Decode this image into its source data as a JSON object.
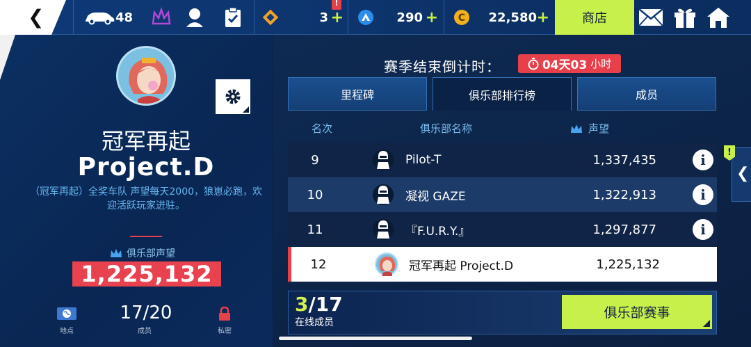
{
  "topbar": {
    "cars_count": "48",
    "tokens": "3",
    "blueprints": "290",
    "credits": "22,580",
    "shop_label": "商店"
  },
  "club": {
    "name_cn": "冠军再起",
    "name_en": "Project.D",
    "description": "（冠军再起）全奖车队 声望每天2000，狼崽必跑，欢迎活跃玩家进驻。",
    "reputation_label": "俱乐部声望",
    "reputation": "1,225,132",
    "location_label": "地点",
    "members": "17/20",
    "members_label": "成员",
    "privacy_label": "私密"
  },
  "season": {
    "countdown_label": "赛季结束倒计时：",
    "countdown_days": "04天03",
    "countdown_unit": "小时"
  },
  "tabs": [
    {
      "label": "里程碑"
    },
    {
      "label": "俱乐部排行榜"
    },
    {
      "label": "成员"
    }
  ],
  "table": {
    "headers": {
      "rank": "名次",
      "name": "俱乐部名称",
      "reputation": "声望"
    },
    "rows": [
      {
        "rank": "9",
        "name": "Pilot-T",
        "reputation": "1,337,435"
      },
      {
        "rank": "10",
        "name": "凝视 GAZE",
        "reputation": "1,322,913"
      },
      {
        "rank": "11",
        "name": "『F.U.R.Y.』",
        "reputation": "1,297,877"
      },
      {
        "rank": "12",
        "name": "冠军再起 Project.D",
        "reputation": "1,225,132"
      }
    ]
  },
  "footer": {
    "online_current": "3",
    "online_total": "/17",
    "online_label": "在线成员",
    "club_event_label": "俱乐部赛事"
  },
  "colors": {
    "accent_green": "#c8f04a",
    "accent_red": "#e8404b",
    "bg_dark": "#0b2247"
  }
}
